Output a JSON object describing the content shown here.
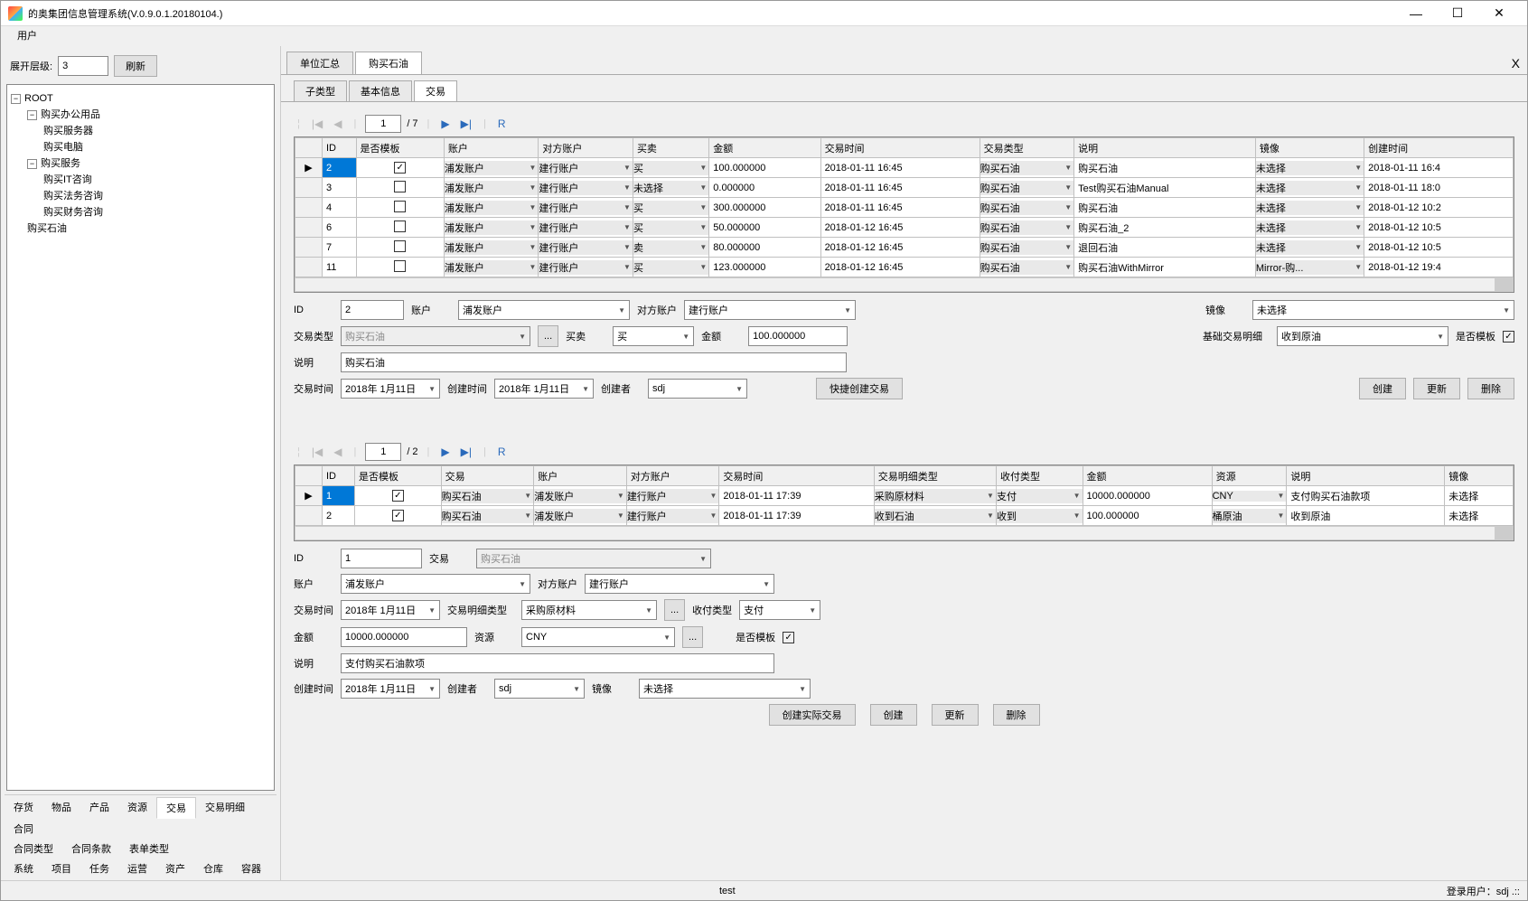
{
  "window": {
    "title": "的奥集团信息管理系统(V.0.9.0.1.20180104.)"
  },
  "menubar": {
    "user": "用户"
  },
  "left": {
    "expand_label": "展开层级:",
    "expand_value": "3",
    "refresh": "刷新",
    "tree": {
      "root": "ROOT",
      "n1": "购买办公用品",
      "n1a": "购买服务器",
      "n1b": "购买电脑",
      "n2": "购买服务",
      "n2a": "购买IT咨询",
      "n2b": "购买法务咨询",
      "n2c": "购买财务咨询",
      "n3": "购买石油"
    },
    "tabs1": [
      "存货",
      "物品",
      "产品",
      "资源",
      "交易",
      "交易明细",
      "合同"
    ],
    "tabs2": [
      "合同类型",
      "合同条款",
      "表单类型"
    ],
    "tabs3": [
      "系统",
      "项目",
      "任务",
      "运营",
      "资产",
      "仓库",
      "容器"
    ],
    "active_tab": "交易"
  },
  "top_tabs": {
    "t1": "单位汇总",
    "t2": "购买石油",
    "close": "X"
  },
  "sub_tabs": {
    "s1": "子类型",
    "s2": "基本信息",
    "s3": "交易"
  },
  "nav1": {
    "page": "1",
    "total": "/ 7",
    "r": "R"
  },
  "grid1": {
    "headers": [
      "",
      "ID",
      "是否模板",
      "账户",
      "对方账户",
      "买卖",
      "金额",
      "交易时间",
      "交易类型",
      "说明",
      "镜像",
      "创建时间"
    ],
    "rows": [
      {
        "mark": "▶",
        "id": "2",
        "tpl": true,
        "acct": "浦发账户",
        "opp": "建行账户",
        "bs": "买",
        "amt": "100.000000",
        "time": "2018-01-11 16:45",
        "type": "购买石油",
        "desc": "购买石油",
        "mirror": "未选择",
        "ctime": "2018-01-11 16:4"
      },
      {
        "mark": "",
        "id": "3",
        "tpl": false,
        "acct": "浦发账户",
        "opp": "建行账户",
        "bs": "未选择",
        "amt": "0.000000",
        "time": "2018-01-11 16:45",
        "type": "购买石油",
        "desc": "Test购买石油Manual",
        "mirror": "未选择",
        "ctime": "2018-01-11 18:0"
      },
      {
        "mark": "",
        "id": "4",
        "tpl": false,
        "acct": "浦发账户",
        "opp": "建行账户",
        "bs": "买",
        "amt": "300.000000",
        "time": "2018-01-11 16:45",
        "type": "购买石油",
        "desc": "购买石油",
        "mirror": "未选择",
        "ctime": "2018-01-12 10:2"
      },
      {
        "mark": "",
        "id": "6",
        "tpl": false,
        "acct": "浦发账户",
        "opp": "建行账户",
        "bs": "买",
        "amt": "50.000000",
        "time": "2018-01-12 16:45",
        "type": "购买石油",
        "desc": "购买石油_2",
        "mirror": "未选择",
        "ctime": "2018-01-12 10:5"
      },
      {
        "mark": "",
        "id": "7",
        "tpl": false,
        "acct": "浦发账户",
        "opp": "建行账户",
        "bs": "卖",
        "amt": "80.000000",
        "time": "2018-01-12 16:45",
        "type": "购买石油",
        "desc": "退回石油",
        "mirror": "未选择",
        "ctime": "2018-01-12 10:5"
      },
      {
        "mark": "",
        "id": "11",
        "tpl": false,
        "acct": "浦发账户",
        "opp": "建行账户",
        "bs": "买",
        "amt": "123.000000",
        "time": "2018-01-12 16:45",
        "type": "购买石油",
        "desc": "购买石油WithMirror",
        "mirror": "Mirror-购...",
        "ctime": "2018-01-12 19:4"
      }
    ]
  },
  "form1": {
    "id_l": "ID",
    "id_v": "2",
    "acct_l": "账户",
    "acct_v": "浦发账户",
    "opp_l": "对方账户",
    "opp_v": "建行账户",
    "mirror_l": "镜像",
    "mirror_v": "未选择",
    "type_l": "交易类型",
    "type_v": "购买石油",
    "dots": "...",
    "bs_l": "买卖",
    "bs_v": "买",
    "amt_l": "金额",
    "amt_v": "100.000000",
    "base_l": "基础交易明细",
    "base_v": "收到原油",
    "tpl_l": "是否模板",
    "desc_l": "说明",
    "desc_v": "购买石油",
    "ttime_l": "交易时间",
    "ttime_v": "2018年 1月11日",
    "ctime_l": "创建时间",
    "ctime_v": "2018年 1月11日",
    "creator_l": "创建者",
    "creator_v": "sdj",
    "quick": "快捷创建交易",
    "create": "创建",
    "update": "更新",
    "delete": "删除"
  },
  "nav2": {
    "page": "1",
    "total": "/ 2",
    "r": "R"
  },
  "grid2": {
    "headers": [
      "",
      "ID",
      "是否模板",
      "交易",
      "账户",
      "对方账户",
      "交易时间",
      "交易明细类型",
      "收付类型",
      "金额",
      "资源",
      "说明",
      "镜像"
    ],
    "rows": [
      {
        "mark": "▶",
        "id": "1",
        "tpl": true,
        "trade": "购买石油",
        "acct": "浦发账户",
        "opp": "建行账户",
        "time": "2018-01-11 17:39",
        "dtype": "采购原材料",
        "rtype": "支付",
        "amt": "10000.000000",
        "res": "CNY",
        "desc": "支付购买石油款项",
        "mirror": "未选择"
      },
      {
        "mark": "",
        "id": "2",
        "tpl": true,
        "trade": "购买石油",
        "acct": "浦发账户",
        "opp": "建行账户",
        "time": "2018-01-11 17:39",
        "dtype": "收到石油",
        "rtype": "收到",
        "amt": "100.000000",
        "res": "桶原油",
        "desc": "收到原油",
        "mirror": "未选择"
      }
    ]
  },
  "form2": {
    "id_l": "ID",
    "id_v": "1",
    "trade_l": "交易",
    "trade_v": "购买石油",
    "acct_l": "账户",
    "acct_v": "浦发账户",
    "opp_l": "对方账户",
    "opp_v": "建行账户",
    "ttime_l": "交易时间",
    "ttime_v": "2018年 1月11日",
    "dtype_l": "交易明细类型",
    "dtype_v": "采购原材料",
    "dots": "...",
    "rtype_l": "收付类型",
    "rtype_v": "支付",
    "amt_l": "金额",
    "amt_v": "10000.000000",
    "res_l": "资源",
    "res_v": "CNY",
    "tpl_l": "是否模板",
    "desc_l": "说明",
    "desc_v": "支付购买石油款项",
    "ctime_l": "创建时间",
    "ctime_v": "2018年 1月11日",
    "creator_l": "创建者",
    "creator_v": "sdj",
    "mirror_l": "镜像",
    "mirror_v": "未选择",
    "create_real": "创建实际交易",
    "create": "创建",
    "update": "更新",
    "delete": "删除"
  },
  "status": {
    "test": "test",
    "login": "登录用户：sdj .::"
  }
}
